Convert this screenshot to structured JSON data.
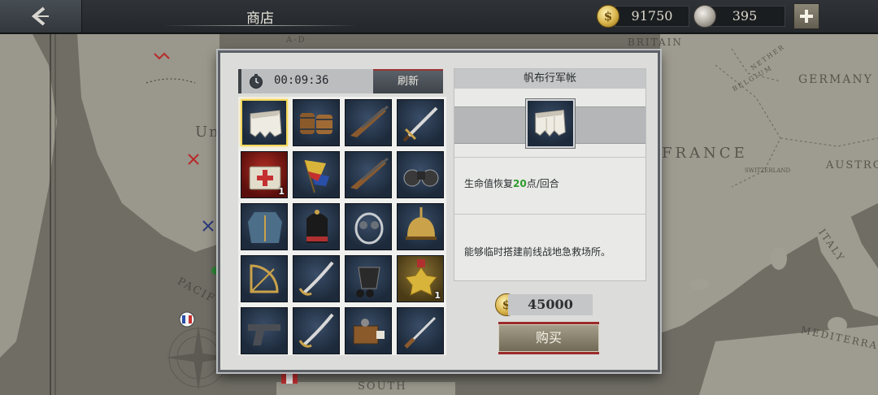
{
  "header": {
    "back_icon": "chevron-left-icon",
    "title": "商店",
    "gold": "91750",
    "medals": "395",
    "plus_icon": "plus-icon"
  },
  "map": {
    "labels": [
      "BRITAIN",
      "GERMANY",
      "FRANCE",
      "AUSTRO-",
      "ITALY",
      "MEDITERRAN",
      "SOUTH",
      "PACIF",
      "Un",
      "NETHER",
      "BELGIUM",
      "SWITZERLAND",
      "A-D"
    ]
  },
  "shop": {
    "timer": "00:09:36",
    "timer_icon": "stopwatch-icon",
    "refresh_label": "刷新",
    "items": [
      {
        "name": "tent",
        "icon": "tent-icon",
        "count": ""
      },
      {
        "name": "barrels",
        "icon": "barrel-icon",
        "count": ""
      },
      {
        "name": "rifle",
        "icon": "rifle-icon",
        "count": ""
      },
      {
        "name": "sword",
        "icon": "sword-icon",
        "count": ""
      },
      {
        "name": "medkit",
        "icon": "medkit-icon",
        "count": "1"
      },
      {
        "name": "signal-flags",
        "icon": "flag-icon",
        "count": ""
      },
      {
        "name": "rifle-2",
        "icon": "rifle-icon",
        "count": ""
      },
      {
        "name": "binoculars",
        "icon": "binoculars-icon",
        "count": ""
      },
      {
        "name": "uniform",
        "icon": "uniform-icon",
        "count": ""
      },
      {
        "name": "busby-hat",
        "icon": "hat-icon",
        "count": ""
      },
      {
        "name": "gas-mask",
        "icon": "mask-icon",
        "count": ""
      },
      {
        "name": "pickelhaube",
        "icon": "helmet-icon",
        "count": ""
      },
      {
        "name": "sextant",
        "icon": "sextant-icon",
        "count": ""
      },
      {
        "name": "saber",
        "icon": "saber-icon",
        "count": ""
      },
      {
        "name": "bucket-cannonballs",
        "icon": "bucket-icon",
        "count": ""
      },
      {
        "name": "medal",
        "icon": "medal-icon",
        "count": "1"
      },
      {
        "name": "pistol",
        "icon": "pistol-icon",
        "count": ""
      },
      {
        "name": "cavalry-saber",
        "icon": "saber-icon",
        "count": ""
      },
      {
        "name": "ammo-crate",
        "icon": "crate-icon",
        "count": ""
      },
      {
        "name": "dagger",
        "icon": "dagger-icon",
        "count": ""
      }
    ],
    "selected_index": 0
  },
  "detail": {
    "title": "帆布行军帐",
    "effect_prefix": "生命值恢复",
    "effect_value": "20",
    "effect_suffix": "点/回合",
    "description": "能够临时搭建前线战地急救场所。",
    "price": "45000",
    "buy_label": "购买"
  },
  "colors": {
    "selected_border": "#f2d75a",
    "effect_value": "#2f9a2b",
    "buy_accent": "#9b2a2a"
  }
}
